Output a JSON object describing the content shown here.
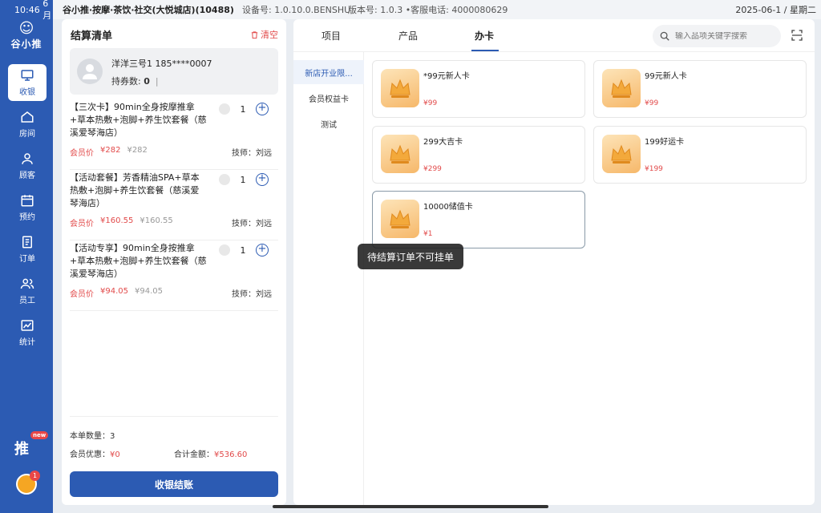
{
  "status_bar": {
    "time": "10:46",
    "time_suffix": "6月",
    "store_name": "谷小推·按摩·茶饮·社交(大悦城店)(10488)",
    "device": "设备号: 1.0.10.0.BENSHU",
    "version": "版本号: 1.0.3 •客服电话: 4000080629",
    "date": "2025-06-1 / 星期二"
  },
  "sidebar": {
    "logo_text": "谷小推",
    "items": [
      {
        "label": "收银",
        "icon": "monitor-icon"
      },
      {
        "label": "房间",
        "icon": "home-icon"
      },
      {
        "label": "顾客",
        "icon": "user-icon"
      },
      {
        "label": "预约",
        "icon": "calendar-icon"
      },
      {
        "label": "订单",
        "icon": "document-icon"
      },
      {
        "label": "员工",
        "icon": "staff-icon"
      },
      {
        "label": "统计",
        "icon": "chart-icon"
      }
    ],
    "promo_text": "推",
    "promo_badge": "new",
    "avatar_badge": "1"
  },
  "checkout": {
    "title": "结算清单",
    "clear_label": "清空",
    "member": {
      "name": "洋洋三号1 185****0007",
      "coupon_label": "持券数:",
      "coupon_count": "0"
    },
    "items": [
      {
        "name": "【三次卡】90min全身按摩推拿+草本热敷+泡脚+养生饮套餐（慈溪爱琴海店）",
        "qty": "1",
        "member_label": "会员价",
        "member_price": "¥282",
        "original_price": "¥282",
        "tech": "技师：刘远"
      },
      {
        "name": "【活动套餐】芳香精油SPA+草本热敷+泡脚+养生饮套餐（慈溪爱琴海店）",
        "qty": "1",
        "member_label": "会员价",
        "member_price": "¥160.55",
        "original_price": "¥160.55",
        "tech": "技师：刘远"
      },
      {
        "name": "【活动专享】90min全身按推拿+草本热敷+泡脚+养生饮套餐（慈溪爱琴海店）",
        "qty": "1",
        "member_label": "会员价",
        "member_price": "¥94.05",
        "original_price": "¥94.05",
        "tech": "技师：刘远"
      }
    ],
    "count_label": "本单数量：",
    "count_value": "3",
    "discount_label": "会员优惠：",
    "discount_value": "¥0",
    "total_label": "合计金额：",
    "total_value": "¥536.60",
    "pay_label": "收银结账"
  },
  "catalog": {
    "tabs": [
      "项目",
      "产品",
      "办卡"
    ],
    "active_tab": "办卡",
    "search_placeholder": "输入品项关键字搜索",
    "categories": [
      "新店开业限...",
      "会员权益卡",
      "测试"
    ],
    "cards": [
      {
        "name": "*99元新人卡",
        "price": "¥99"
      },
      {
        "name": "99元新人卡",
        "price": "¥99"
      },
      {
        "name": "299大吉卡",
        "price": "¥299"
      },
      {
        "name": "199好运卡",
        "price": "¥199"
      },
      {
        "name": "10000储值卡",
        "price": "¥1"
      }
    ]
  },
  "toast": "待结算订单不可挂单",
  "colors": {
    "brand": "#2c5bb3",
    "price_red": "#e24b4b"
  }
}
